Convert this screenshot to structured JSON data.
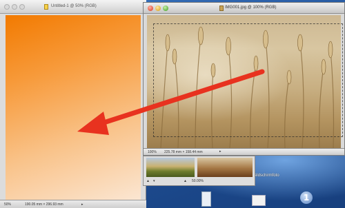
{
  "left_window": {
    "title": "Untitled-1 @ 50% (RGB)",
    "zoom": "50%",
    "dimensions": "190.05 mm × 296.93 mm"
  },
  "right_window": {
    "title": "IMG001.jpg @ 100% (RGB)",
    "zoom": "100%",
    "dimensions": "225.78 mm × 158.44 mm"
  },
  "palette": {
    "zoom_level": "50.00%"
  },
  "desktop": {
    "label": "Bildschirmfoto"
  },
  "colors": {
    "arrow": "#e8321f",
    "orange_start": "#f27a00",
    "orange_end": "#fbe6d2"
  },
  "icons": [
    "close-icon",
    "minimize-icon",
    "zoom-icon",
    "document-icon",
    "drag-arrow-icon"
  ]
}
